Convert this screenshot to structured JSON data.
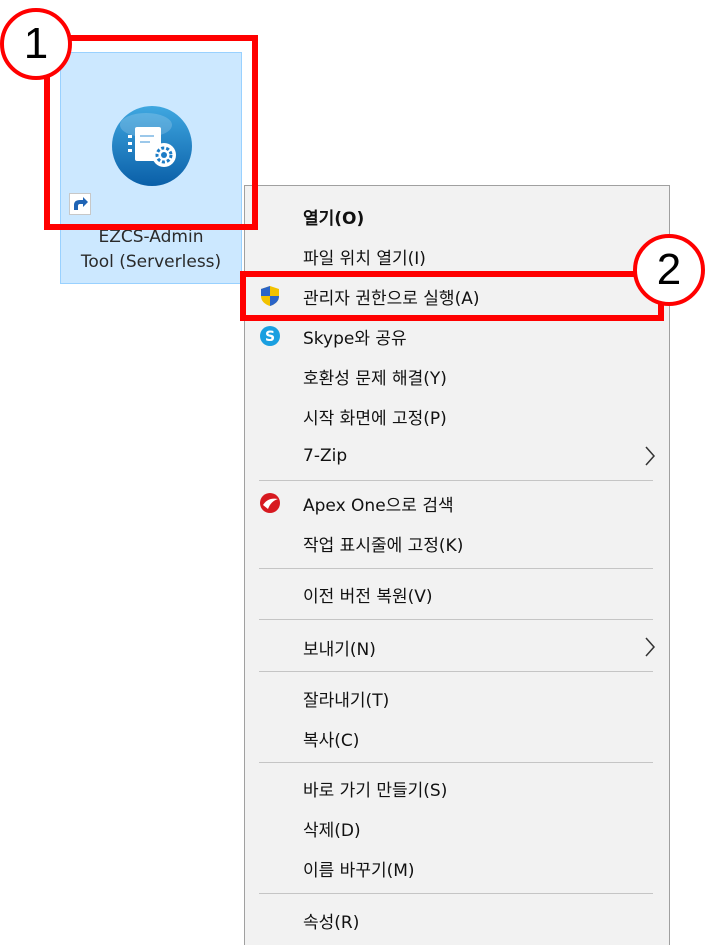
{
  "desktop_icon": {
    "label_line1": "EZCS-Admin",
    "label_line2": "Tool (Serverless)",
    "icon": "ezcs-admin-app-icon",
    "shortcut_icon": "shortcut-arrow-icon"
  },
  "annotations": {
    "step1": "1",
    "step2": "2",
    "color": "#ff0000"
  },
  "context_menu": {
    "items": [
      {
        "label": "열기(O)",
        "bold": true
      },
      {
        "label": "파일 위치 열기(I)"
      },
      {
        "label": "관리자 권한으로 실행(A)",
        "icon": "uac-shield-icon"
      },
      {
        "label": "Skype와 공유",
        "icon": "skype-icon"
      },
      {
        "label": "호환성 문제 해결(Y)"
      },
      {
        "label": "시작 화면에 고정(P)"
      },
      {
        "label": "7-Zip",
        "submenu": true
      },
      {
        "label": "Apex One으로 검색",
        "icon": "apex-one-icon"
      },
      {
        "label": "작업 표시줄에 고정(K)"
      },
      {
        "label": "이전 버전 복원(V)"
      },
      {
        "label": "보내기(N)",
        "submenu": true
      },
      {
        "label": "잘라내기(T)"
      },
      {
        "label": "복사(C)"
      },
      {
        "label": "바로 가기 만들기(S)"
      },
      {
        "label": "삭제(D)"
      },
      {
        "label": "이름 바꾸기(M)"
      },
      {
        "label": "속성(R)"
      }
    ]
  }
}
